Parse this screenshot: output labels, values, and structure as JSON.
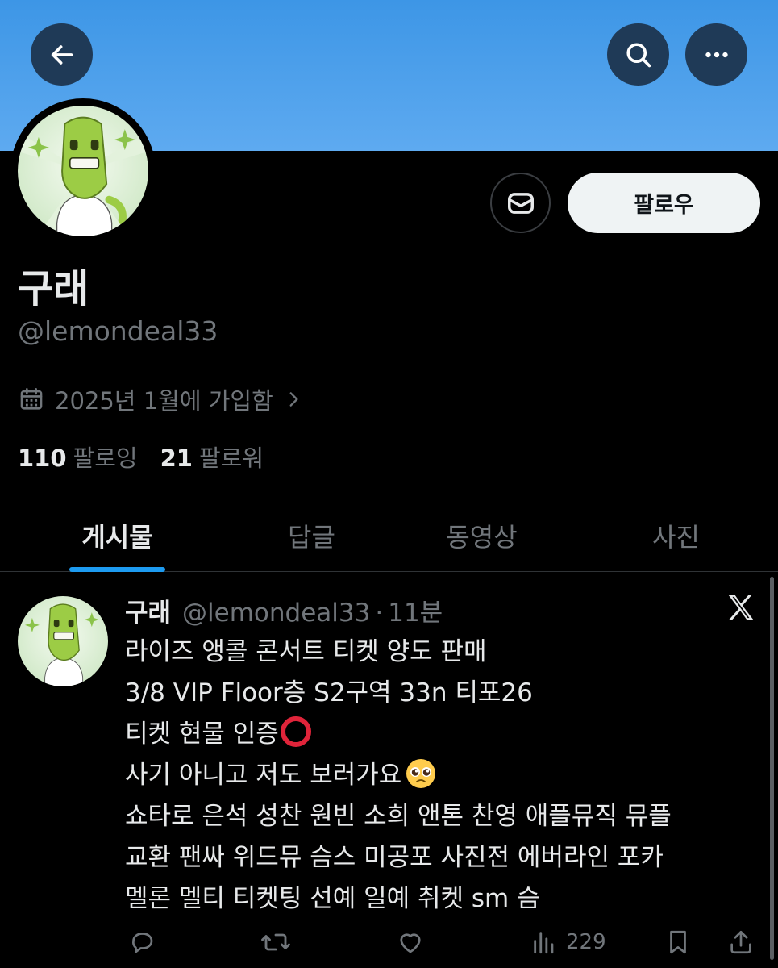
{
  "header": {
    "back_icon": "arrow-left-icon",
    "search_icon": "search-icon",
    "more_icon": "more-horizontal-icon",
    "banner_color": "#4a9fea"
  },
  "profile": {
    "display_name": "구래",
    "handle": "@lemondeal33",
    "joined": "2025년 1월에 가입함",
    "following_count": "110",
    "following_label": "팔로잉",
    "followers_count": "21",
    "followers_label": "팔로워",
    "follow_button": "팔로우",
    "message_icon": "envelope-icon"
  },
  "tabs": [
    {
      "label": "게시물",
      "active": true
    },
    {
      "label": "답글",
      "active": false
    },
    {
      "label": "동영상",
      "active": false
    },
    {
      "label": "사진",
      "active": false
    }
  ],
  "post": {
    "author_name": "구래",
    "author_handle": "@lemondeal33",
    "separator": "·",
    "time": "11분",
    "lines": [
      "라이즈 앵콜 콘서트 티켓 양도 판매",
      "3/8 VIP Floor층 S2구역 33n 티포26",
      "티켓 현물 인증",
      "사기 아니고 저도 보러가요",
      "쇼타로 은석 성찬 원빈 소희 앤톤 찬영 애플뮤직 뮤플",
      "교환 팬싸 위드뮤 슴스 미공포 사진전 에버라인 포카",
      "멜론 멜티 티켓팅 선예 일예 취켓 sm 슴"
    ],
    "emoji_line3": "heavy-large-circle-emoji",
    "emoji_line4": "pleading-face-emoji",
    "views": "229"
  },
  "colors": {
    "accent": "#1d9bf0",
    "secondary_text": "#71767b",
    "primary_text": "#e7e9ea",
    "background": "#000000"
  }
}
